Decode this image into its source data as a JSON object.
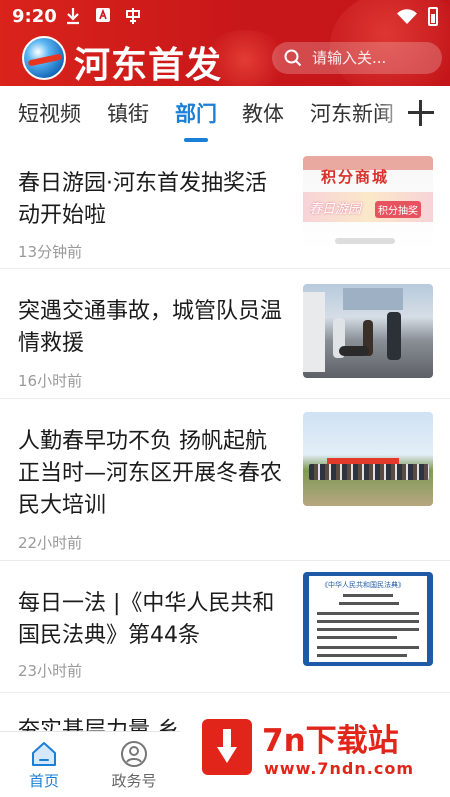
{
  "status": {
    "time": "9:20"
  },
  "header": {
    "app_name": "河东首发",
    "search_placeholder": "请输入关..."
  },
  "tabs": [
    {
      "label": "短视频",
      "active": false
    },
    {
      "label": "镇街",
      "active": false
    },
    {
      "label": "部门",
      "active": true
    },
    {
      "label": "教体",
      "active": false
    },
    {
      "label": "河东新闻",
      "active": false
    }
  ],
  "news": [
    {
      "title": "春日游园·河东首发抽奖活动开始啦",
      "time": "13分钟前",
      "thumb_text": "积分商城",
      "thumb_sub": "春日游园",
      "thumb_badge": "积分抽奖"
    },
    {
      "title": "突遇交通事故，城管队员温情救援",
      "time": "16小时前"
    },
    {
      "title": "人勤春早功不负  扬帆起航正当时—河东区开展冬春农民大培训",
      "time": "22小时前"
    },
    {
      "title": "每日一法  |《中华人民共和国民法典》第44条",
      "time": "23小时前",
      "thumb_text": "《中华人民共和国民法典》"
    }
  ],
  "partial_headline": "夯实基层力量  乡",
  "bottom_nav": [
    {
      "label": "首页",
      "icon": "home-icon",
      "active": true
    },
    {
      "label": "政务号",
      "icon": "user-circle-icon",
      "active": false
    }
  ],
  "watermark": {
    "name": "7n下载站",
    "url": "www.7ndn.com"
  },
  "colors": {
    "header_red": "#d9231b",
    "accent_blue": "#1a7fd6",
    "watermark_red": "#e1251b"
  }
}
